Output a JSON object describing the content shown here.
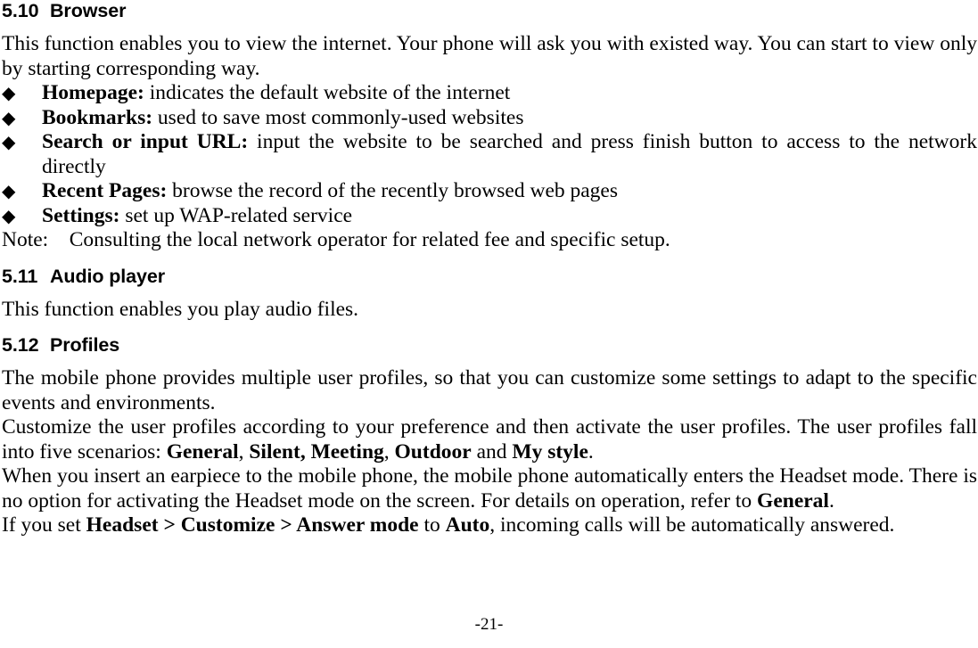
{
  "document": {
    "page_number": "-21-",
    "bullet_glyph": "◆"
  },
  "sections": [
    {
      "number": "5.10",
      "title": "Browser",
      "intro": "This function enables you to view the internet. Your phone will ask you with existed way. You can start to view only by starting corresponding way.",
      "bullets": [
        {
          "term": "Homepage:",
          "description": " indicates the default website of the internet"
        },
        {
          "term": "Bookmarks:",
          "description": " used to save most commonly-used websites"
        },
        {
          "term": "Search or input URL:",
          "description": " input the website to be searched and press finish button to access to the network directly"
        },
        {
          "term": "Recent Pages:",
          "description": " browse the record of the recently browsed web pages"
        },
        {
          "term": "Settings:",
          "description": " set up WAP-related service"
        }
      ],
      "note_label": "Note:",
      "note_text": "Consulting the local network operator for related fee and specific setup."
    },
    {
      "number": "5.11",
      "title": "Audio player",
      "intro": "This function enables you play audio files."
    },
    {
      "number": "5.12",
      "title": "Profiles",
      "para1": "The mobile phone provides multiple user profiles, so that you can customize some settings to adapt to the specific events and environments.",
      "para2_a": "Customize the user profiles according to your preference and then activate the user profiles. The user profiles fall into five scenarios: ",
      "para2_b1": "General",
      "para2_sep1": ", ",
      "para2_b2": "Silent, Meeting",
      "para2_sep2": ", ",
      "para2_b3": "Outdoor",
      "para2_sep3": " and ",
      "para2_b4": "My style",
      "para2_end": ".",
      "para3": "When you insert an earpiece to the mobile phone, the mobile phone automatically enters the Headset mode. There is no option for activating the Headset mode on the screen. For details on operation, refer to ",
      "para3_b1": "General",
      "para3_end": ".",
      "para4_a": "If you set ",
      "para4_b1": "Headset > Customize > Answer mode",
      "para4_mid": " to ",
      "para4_b2": "Auto",
      "para4_end": ", incoming calls will be automatically answered."
    }
  ]
}
